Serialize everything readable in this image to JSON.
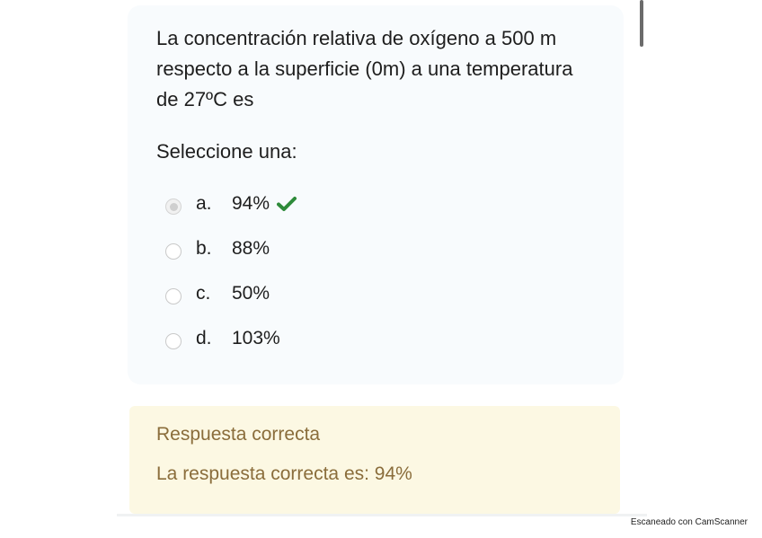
{
  "question": {
    "text": "La concentración relativa de oxígeno a 500 m respecto a la superficie (0m) a una temperatura de 27ºC es",
    "prompt": "Seleccione una:",
    "options": [
      {
        "letter": "a.",
        "text": "94%",
        "selected": true,
        "correct_mark": "check-icon"
      },
      {
        "letter": "b.",
        "text": "88%",
        "selected": false
      },
      {
        "letter": "c.",
        "text": "50%",
        "selected": false
      },
      {
        "letter": "d.",
        "text": "103%",
        "selected": false
      }
    ]
  },
  "feedback": {
    "status": "Respuesta correcta",
    "correct_answer": "La respuesta correcta es: 94%"
  },
  "watermark": "Escaneado con CamScanner",
  "colors": {
    "check": "#2e8b3a",
    "feedback_text": "#8a6d3b",
    "feedback_bg": "#fcf8e3",
    "card_bg": "#f8fbfd"
  }
}
